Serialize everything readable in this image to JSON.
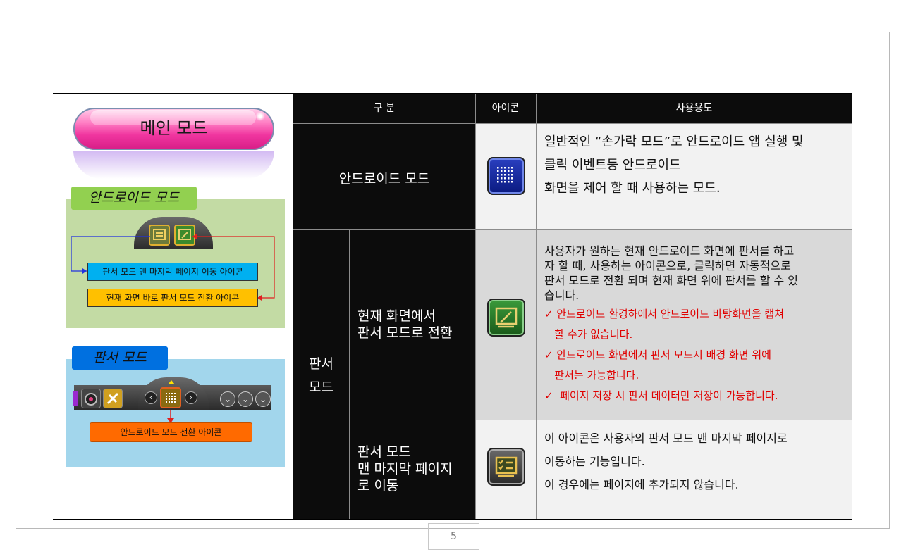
{
  "left": {
    "main_mode_label": "메인 모드",
    "android_tag": "안드로이드 모드",
    "android_box1": "판서 모드 맨 마지막 페이지 이동 아이콘",
    "android_box2": "현재 화면 바로 판서 모드 전환 아이콘",
    "board_tag": "판서 모드",
    "board_box": "안드로이드 모드 전환 아이콘"
  },
  "table": {
    "headers": [
      "구 분",
      "아이콘",
      "사용용도"
    ],
    "rows": [
      {
        "category": "안드로이드 모드",
        "icon": "android-grid-icon",
        "lines": [
          "일반적인 “손가락 모드”로  안드로이드 앱 실행 및",
          "클릭 이벤트등 안드로이드",
          "화면을 제어 할 때 사용하는 모드."
        ]
      },
      {
        "group": "판서\n모드",
        "group_lines": [
          "판서",
          "모드"
        ],
        "category_lines": [
          "현재 화면에서",
          "판서 모드로 전환"
        ],
        "icon": "board-pen-icon",
        "lines": [
          "사용자가 원하는 현재 안드로이드 화면에 판서를 하고",
          "자 할 때,  사용하는 아이콘으로, 클릭하면  자동적으로",
          "판서 모드로 전환 되며 현재 화면 위에 판서를 할 수 있",
          "습니다."
        ],
        "notes": [
          "✓ 안드로이드 환경하에서 안드로이드 바탕화면을 캡쳐",
          "   할 수가 없습니다.",
          "✓ 안드로이드 화면에서 판서 모드시 배경 화면 위에",
          "   판서는 가능합니다.",
          "✓  페이지 저장 시 판서 데이터만 저장이 가능합니다."
        ]
      },
      {
        "category_lines": [
          "판서 모드",
          "맨 마지막 페이지",
          "로 이동"
        ],
        "icon": "board-checklist-icon",
        "lines": [
          "이 아이콘은 사용자의 판서 모드 맨 마지막 페이지로",
          "이동하는 기능입니다.",
          "이 경우에는 페이지에 추가되지  않습니다."
        ]
      }
    ]
  },
  "page_number": "5",
  "colors": {
    "note_red": "#e00000",
    "header_bg": "#0c0c0c",
    "green_panel": "#c3dba4",
    "blue_panel": "#a2d6ec"
  }
}
